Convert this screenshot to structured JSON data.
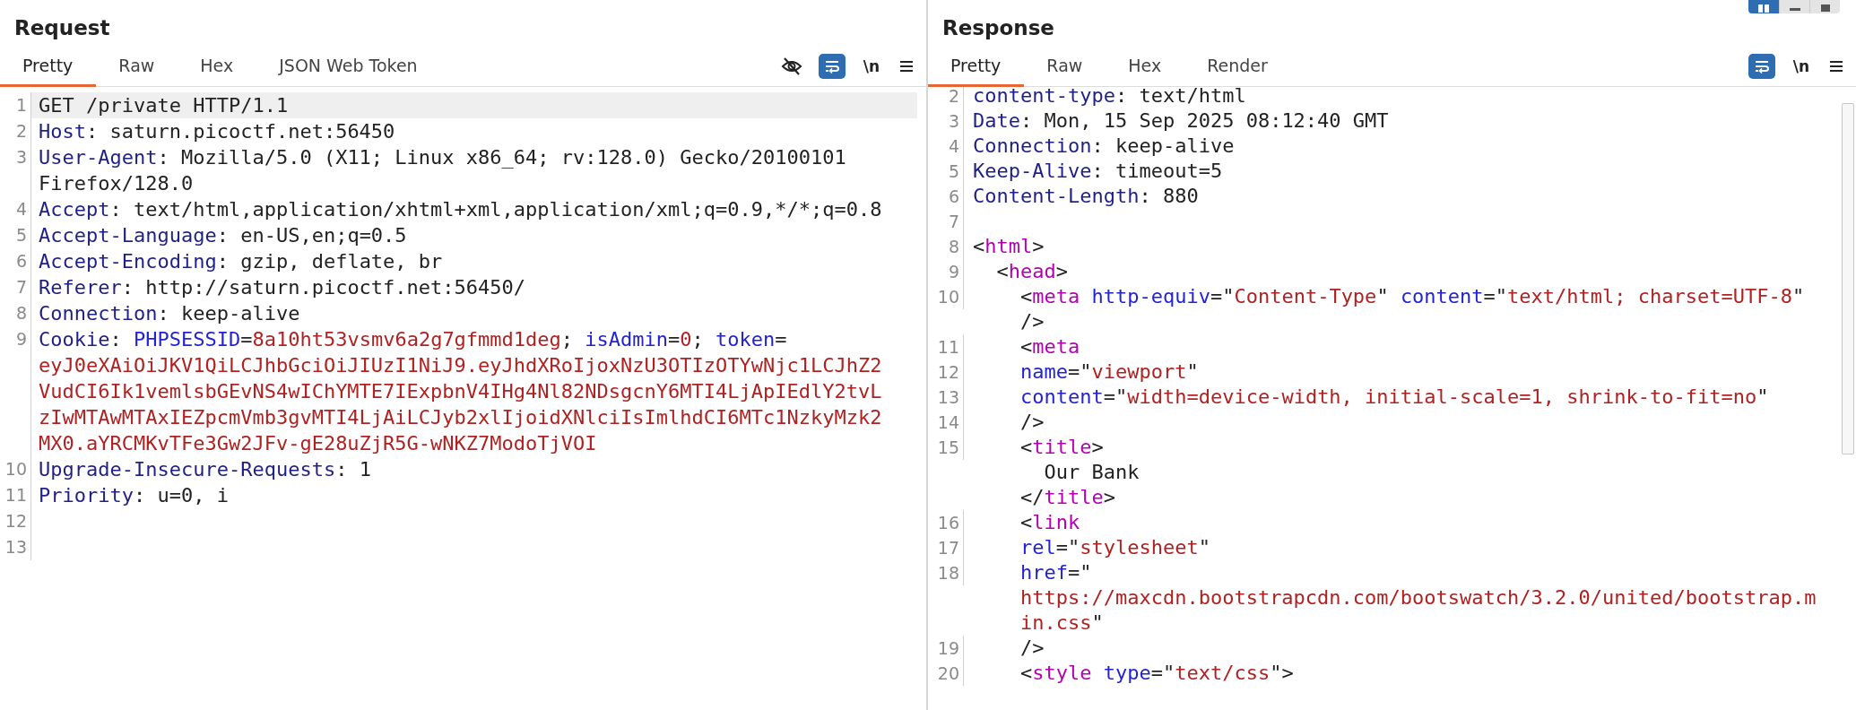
{
  "layout_buttons": [
    {
      "kind": "columns",
      "selected": true
    },
    {
      "kind": "rows",
      "selected": false
    },
    {
      "kind": "single",
      "selected": false
    }
  ],
  "request": {
    "title": "Request",
    "tabs": [
      {
        "label": "Pretty",
        "selected": true
      },
      {
        "label": "Raw",
        "selected": false
      },
      {
        "label": "Hex",
        "selected": false
      },
      {
        "label": "JSON Web Token",
        "selected": false
      }
    ],
    "toolbar": [
      {
        "kind": "hide",
        "on": false
      },
      {
        "kind": "wrap",
        "on": true
      },
      {
        "kind": "newline",
        "label": "\\n",
        "on": false
      },
      {
        "kind": "menu",
        "on": false
      }
    ],
    "lines": [
      {
        "number": "1",
        "current": true,
        "rows": [
          {
            "tokens": [
              {
                "kind": "plain",
                "text": "GET /private HTTP/1.1"
              }
            ]
          }
        ]
      },
      {
        "number": "2",
        "current": false,
        "rows": [
          {
            "tokens": [
              {
                "kind": "header",
                "text": "Host"
              },
              {
                "kind": "plain",
                "text": ": saturn.picoctf.net:56450"
              }
            ]
          }
        ]
      },
      {
        "number": "3",
        "current": false,
        "rows": [
          {
            "tokens": [
              {
                "kind": "header",
                "text": "User-Agent"
              },
              {
                "kind": "plain",
                "text": ": Mozilla/5.0 (X11; Linux x86_64; rv:128.0) Gecko/20100101"
              }
            ]
          },
          {
            "tokens": [
              {
                "kind": "plain",
                "text": "Firefox/128.0"
              }
            ]
          }
        ]
      },
      {
        "number": "4",
        "current": false,
        "rows": [
          {
            "tokens": [
              {
                "kind": "header",
                "text": "Accept"
              },
              {
                "kind": "plain",
                "text": ": text/html,application/xhtml+xml,application/xml;q=0.9,*/*;q=0.8"
              }
            ]
          }
        ]
      },
      {
        "number": "5",
        "current": false,
        "rows": [
          {
            "tokens": [
              {
                "kind": "header",
                "text": "Accept-Language"
              },
              {
                "kind": "plain",
                "text": ": en-US,en;q=0.5"
              }
            ]
          }
        ]
      },
      {
        "number": "6",
        "current": false,
        "rows": [
          {
            "tokens": [
              {
                "kind": "header",
                "text": "Accept-Encoding"
              },
              {
                "kind": "plain",
                "text": ": gzip, deflate, br"
              }
            ]
          }
        ]
      },
      {
        "number": "7",
        "current": false,
        "rows": [
          {
            "tokens": [
              {
                "kind": "header",
                "text": "Referer"
              },
              {
                "kind": "plain",
                "text": ": http://saturn.picoctf.net:56450/"
              }
            ]
          }
        ]
      },
      {
        "number": "8",
        "current": false,
        "rows": [
          {
            "tokens": [
              {
                "kind": "header",
                "text": "Connection"
              },
              {
                "kind": "plain",
                "text": ": keep-alive"
              }
            ]
          }
        ]
      },
      {
        "number": "9",
        "current": false,
        "rows": [
          {
            "tokens": [
              {
                "kind": "header",
                "text": "Cookie"
              },
              {
                "kind": "plain",
                "text": ": "
              },
              {
                "kind": "name",
                "text": "PHPSESSID"
              },
              {
                "kind": "plain",
                "text": "="
              },
              {
                "kind": "value",
                "text": "8a10ht53vsmv6a2g7gfmmd1deg"
              },
              {
                "kind": "plain",
                "text": "; "
              },
              {
                "kind": "name",
                "text": "isAdmin"
              },
              {
                "kind": "plain",
                "text": "="
              },
              {
                "kind": "value",
                "text": "0"
              },
              {
                "kind": "plain",
                "text": "; "
              },
              {
                "kind": "name",
                "text": "token"
              },
              {
                "kind": "plain",
                "text": "="
              }
            ]
          },
          {
            "tokens": [
              {
                "kind": "value",
                "text": "eyJ0eXAiOiJKV1QiLCJhbGciOiJIUzI1NiJ9.eyJhdXRoIjoxNzU3OTIzOTYwNjc1LCJhZ2"
              }
            ]
          },
          {
            "tokens": [
              {
                "kind": "value",
                "text": "VudCI6Ik1vemlsbGEvNS4wIChYMTE7IExpbnV4IHg4Nl82NDsgcnY6MTI4LjApIEdlY2tvL"
              }
            ]
          },
          {
            "tokens": [
              {
                "kind": "value",
                "text": "zIwMTAwMTAxIEZpcmVmb3gvMTI4LjAiLCJyb2xlIjoidXNlciIsImlhdCI6MTc1NzkyMzk2"
              }
            ]
          },
          {
            "tokens": [
              {
                "kind": "value",
                "text": "MX0.aYRCMKvTFe3Gw2JFv-gE28uZjR5G-wNKZ7ModoTjVOI"
              }
            ]
          }
        ]
      },
      {
        "number": "10",
        "current": false,
        "rows": [
          {
            "tokens": [
              {
                "kind": "header",
                "text": "Upgrade-Insecure-Requests"
              },
              {
                "kind": "plain",
                "text": ": 1"
              }
            ]
          }
        ]
      },
      {
        "number": "11",
        "current": false,
        "rows": [
          {
            "tokens": [
              {
                "kind": "header",
                "text": "Priority"
              },
              {
                "kind": "plain",
                "text": ": u=0, i"
              }
            ]
          }
        ]
      },
      {
        "number": "12",
        "current": false
      },
      {
        "number": "13",
        "current": false
      }
    ]
  },
  "response": {
    "title": "Response",
    "tabs": [
      {
        "label": "Pretty",
        "selected": true
      },
      {
        "label": "Raw",
        "selected": false
      },
      {
        "label": "Hex",
        "selected": false
      },
      {
        "label": "Render",
        "selected": false
      }
    ],
    "toolbar": [
      {
        "kind": "wrap",
        "on": true
      },
      {
        "kind": "newline",
        "label": "\\n",
        "on": false
      },
      {
        "kind": "menu",
        "on": false
      }
    ],
    "lines": [
      {
        "number": "2",
        "rows": [
          {
            "tokens": [
              {
                "kind": "header",
                "text": "content-type"
              },
              {
                "kind": "plain",
                "text": ": text/html"
              }
            ]
          }
        ]
      },
      {
        "number": "3",
        "rows": [
          {
            "tokens": [
              {
                "kind": "header",
                "text": "Date"
              },
              {
                "kind": "plain",
                "text": ": Mon, 15 Sep 2025 08:12:40 GMT"
              }
            ]
          }
        ]
      },
      {
        "number": "4",
        "rows": [
          {
            "tokens": [
              {
                "kind": "header",
                "text": "Connection"
              },
              {
                "kind": "plain",
                "text": ": keep-alive"
              }
            ]
          }
        ]
      },
      {
        "number": "5",
        "rows": [
          {
            "tokens": [
              {
                "kind": "header",
                "text": "Keep-Alive"
              },
              {
                "kind": "plain",
                "text": ": timeout=5"
              }
            ]
          }
        ]
      },
      {
        "number": "6",
        "rows": [
          {
            "tokens": [
              {
                "kind": "header",
                "text": "Content-Length"
              },
              {
                "kind": "plain",
                "text": ": 880"
              }
            ]
          }
        ]
      },
      {
        "number": "7"
      },
      {
        "number": "8",
        "rows": [
          {
            "tokens": [
              {
                "kind": "plain",
                "text": "<"
              },
              {
                "kind": "tag",
                "text": "html"
              },
              {
                "kind": "plain",
                "text": ">"
              }
            ]
          }
        ]
      },
      {
        "number": "9",
        "rows": [
          {
            "tokens": [
              {
                "kind": "plain",
                "text": "  <"
              },
              {
                "kind": "tag",
                "text": "head"
              },
              {
                "kind": "plain",
                "text": ">"
              }
            ]
          }
        ]
      },
      {
        "number": "10",
        "rows": [
          {
            "tokens": [
              {
                "kind": "plain",
                "text": "    <"
              },
              {
                "kind": "tag",
                "text": "meta"
              },
              {
                "kind": "name",
                "text": " http-equiv"
              },
              {
                "kind": "plain",
                "text": "=\""
              },
              {
                "kind": "value",
                "text": "Content-Type"
              },
              {
                "kind": "plain",
                "text": "\" "
              },
              {
                "kind": "name",
                "text": "content"
              },
              {
                "kind": "plain",
                "text": "=\""
              },
              {
                "kind": "value",
                "text": "text/html; charset=UTF-8"
              },
              {
                "kind": "plain",
                "text": "\""
              }
            ]
          },
          {
            "tokens": [
              {
                "kind": "plain",
                "text": "    />"
              }
            ]
          }
        ]
      },
      {
        "number": "11",
        "rows": [
          {
            "tokens": [
              {
                "kind": "plain",
                "text": "    <"
              },
              {
                "kind": "tag",
                "text": "meta"
              }
            ]
          }
        ]
      },
      {
        "number": "12",
        "rows": [
          {
            "tokens": [
              {
                "kind": "name",
                "text": "    name"
              },
              {
                "kind": "plain",
                "text": "=\""
              },
              {
                "kind": "value",
                "text": "viewport"
              },
              {
                "kind": "plain",
                "text": "\""
              }
            ]
          }
        ]
      },
      {
        "number": "13",
        "rows": [
          {
            "tokens": [
              {
                "kind": "name",
                "text": "    content"
              },
              {
                "kind": "plain",
                "text": "=\""
              },
              {
                "kind": "value",
                "text": "width=device-width, initial-scale=1, shrink-to-fit=no"
              },
              {
                "kind": "plain",
                "text": "\""
              }
            ]
          }
        ]
      },
      {
        "number": "14",
        "rows": [
          {
            "tokens": [
              {
                "kind": "plain",
                "text": "    />"
              }
            ]
          }
        ]
      },
      {
        "number": "15",
        "rows": [
          {
            "tokens": [
              {
                "kind": "plain",
                "text": "    <"
              },
              {
                "kind": "tag",
                "text": "title"
              },
              {
                "kind": "plain",
                "text": ">"
              }
            ]
          },
          {
            "tokens": [
              {
                "kind": "plain",
                "text": "      Our Bank"
              }
            ]
          },
          {
            "tokens": [
              {
                "kind": "plain",
                "text": "    </"
              },
              {
                "kind": "tag",
                "text": "title"
              },
              {
                "kind": "plain",
                "text": ">"
              }
            ]
          }
        ]
      },
      {
        "number": "16",
        "rows": [
          {
            "tokens": [
              {
                "kind": "plain",
                "text": "    <"
              },
              {
                "kind": "tag",
                "text": "link"
              }
            ]
          }
        ]
      },
      {
        "number": "17",
        "rows": [
          {
            "tokens": [
              {
                "kind": "name",
                "text": "    rel"
              },
              {
                "kind": "plain",
                "text": "=\""
              },
              {
                "kind": "value",
                "text": "stylesheet"
              },
              {
                "kind": "plain",
                "text": "\""
              }
            ]
          }
        ]
      },
      {
        "number": "18",
        "rows": [
          {
            "tokens": [
              {
                "kind": "name",
                "text": "    href"
              },
              {
                "kind": "plain",
                "text": "=\""
              }
            ]
          },
          {
            "tokens": [
              {
                "kind": "value",
                "text": "    https://maxcdn.bootstrapcdn.com/bootswatch/3.2.0/united/bootstrap.m"
              }
            ]
          },
          {
            "tokens": [
              {
                "kind": "value",
                "text": "    in.css"
              },
              {
                "kind": "plain",
                "text": "\""
              }
            ]
          }
        ]
      },
      {
        "number": "19",
        "rows": [
          {
            "tokens": [
              {
                "kind": "plain",
                "text": "    />"
              }
            ]
          }
        ]
      },
      {
        "number": "20",
        "rows": [
          {
            "tokens": [
              {
                "kind": "plain",
                "text": "    <"
              },
              {
                "kind": "tag",
                "text": "style"
              },
              {
                "kind": "name",
                "text": " type"
              },
              {
                "kind": "plain",
                "text": "=\""
              },
              {
                "kind": "value",
                "text": "text/css"
              },
              {
                "kind": "plain",
                "text": "\""
              },
              {
                "kind": "plain",
                "text": ">"
              }
            ]
          }
        ]
      }
    ]
  }
}
